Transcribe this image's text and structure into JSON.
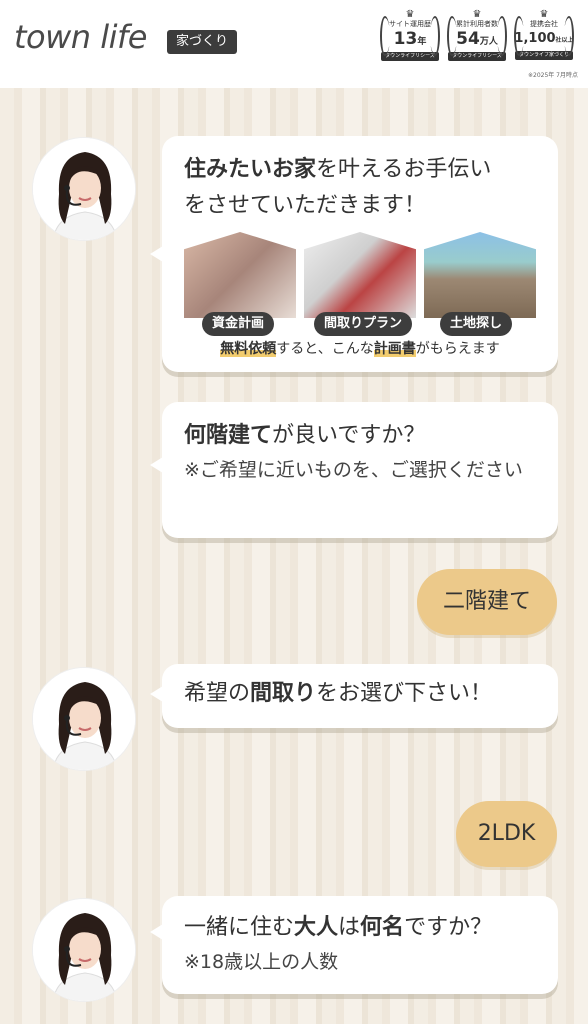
{
  "header": {
    "logo": "town life",
    "tag": "家づくり",
    "awards": [
      {
        "top": "サイト運用歴",
        "value": "13",
        "unit": "年",
        "ribbon": "タウンライフリシーズ"
      },
      {
        "top": "累計利用者数",
        "value": "54",
        "unit": "万人",
        "ribbon": "タウンライフリシーズ"
      },
      {
        "top": "提携会社",
        "value": "1,100",
        "unit": "社以上",
        "ribbon": "タウンライフ家づくり"
      }
    ],
    "award_note": "※2025年 7月時点"
  },
  "chat": {
    "m1": {
      "line1_bold": "住みたいお家",
      "line1_rest": "を叶えるお手伝い",
      "line2": "をさせていただきます！",
      "photo_labels": [
        "資金計画",
        "間取りプラン",
        "土地探し"
      ],
      "foot_pre": "無料依頼",
      "foot_mid": "すると、こんな",
      "foot_hl": "計画書",
      "foot_post": "がもらえます"
    },
    "m2": {
      "bold": "何階建て",
      "rest": "が良いですか？",
      "sub": "※ご希望に近いものを、ご選択ください"
    },
    "a1": "二階建て",
    "m3": {
      "pre": "希望の",
      "bold": "間取り",
      "rest": "をお選び下さい！"
    },
    "a2": "2LDK",
    "m4": {
      "pre": "一緒に住む",
      "bold1": "大人",
      "mid": "は",
      "bold2": "何名",
      "rest": "ですか？",
      "sub": "※18歳以上の人数"
    }
  },
  "colors": {
    "accent": "#ecc98a",
    "highlight": "#f2cc6e",
    "dark": "#3d3d3d"
  }
}
